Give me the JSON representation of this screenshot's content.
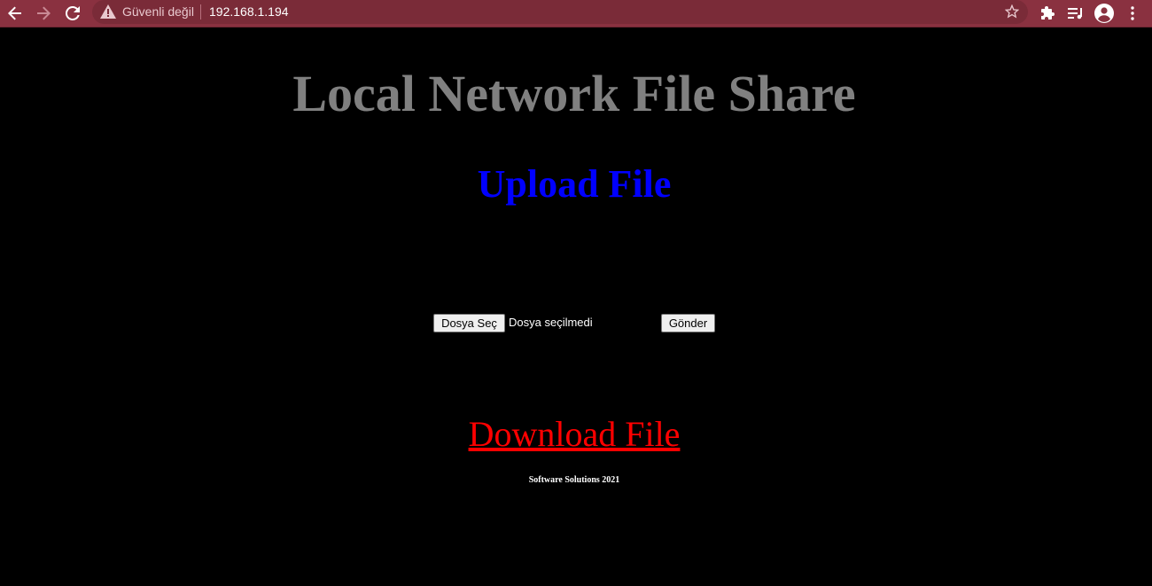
{
  "browser": {
    "security_status": "Güvenli değil",
    "url": "192.168.1.194",
    "icons": {
      "back": "arrow-left-icon",
      "forward": "arrow-right-icon",
      "reload": "reload-icon",
      "warning": "warning-triangle-icon",
      "bookmark": "star-icon",
      "extensions": "puzzle-icon",
      "media": "media-queue-icon",
      "profile": "account-icon",
      "menu": "kebab-menu-icon"
    },
    "toolbar_color": "#8a3140"
  },
  "page": {
    "title": "Local Network File Share",
    "upload_heading": "Upload File",
    "upload_form": {
      "choose_file_label": "Dosya Seç",
      "file_status": "Dosya seçilmedi",
      "submit_label": "Gönder"
    },
    "download_link": "Download File",
    "footer": "Software Solutions 2021",
    "colors": {
      "background": "#000000",
      "title": "#808080",
      "upload_heading": "#0000ff",
      "download_link": "#ff0000",
      "footer": "#ffffff"
    }
  }
}
